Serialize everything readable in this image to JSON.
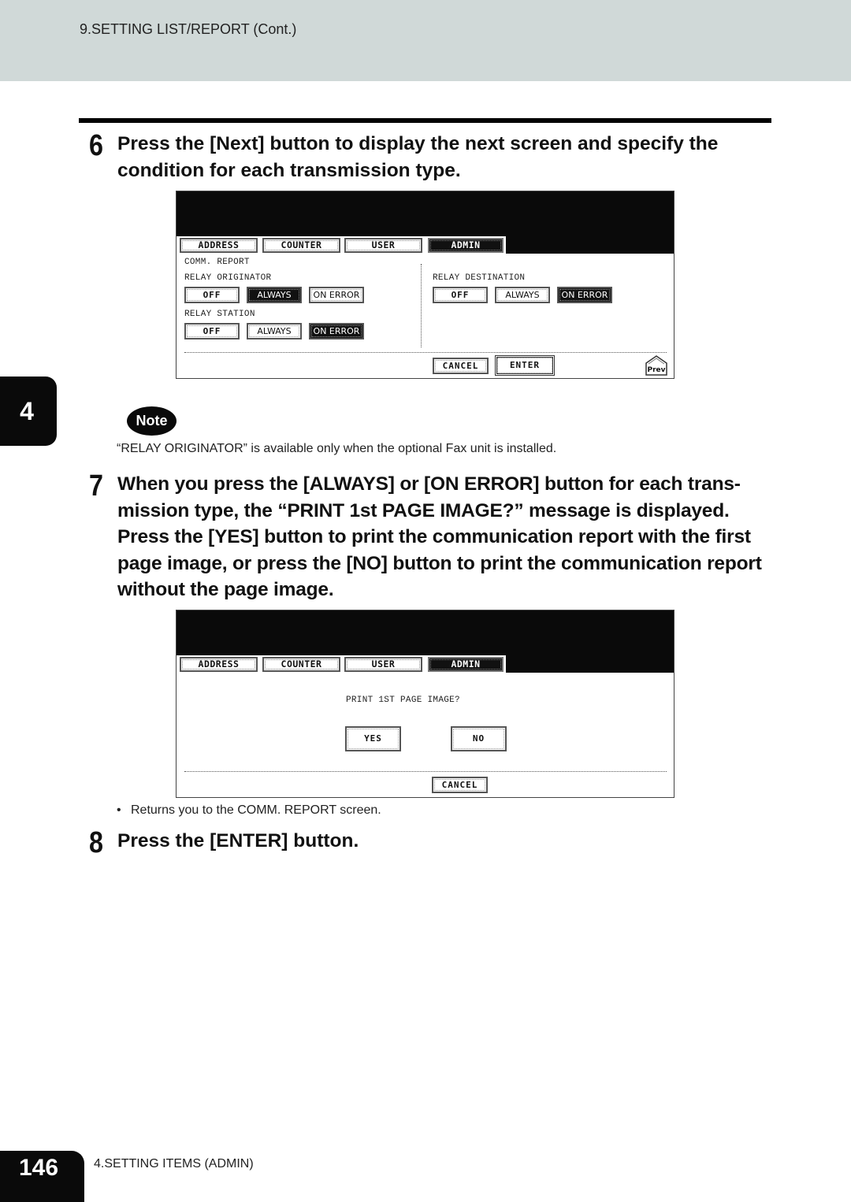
{
  "header": {
    "section_title": "9.SETTING LIST/REPORT (Cont.)"
  },
  "steps": [
    {
      "number": "6",
      "text": "Press the [Next] button to display the next screen and specify the condition for each transmission type."
    },
    {
      "number": "7",
      "text": "When you press the [ALWAYS] or [ON ERROR] button for each trans- mission type, the “PRINT 1st PAGE IMAGE?” message is displayed. Press the [YES] button to print the communication report with the first page image, or press the [NO] button to print the communication report without the page image."
    },
    {
      "number": "8",
      "text": "Press the [ENTER] button."
    }
  ],
  "screen1": {
    "tabs": [
      {
        "label": "ADDRESS",
        "active": false
      },
      {
        "label": "COUNTER",
        "active": false
      },
      {
        "label": "USER",
        "active": false
      },
      {
        "label": "ADMIN",
        "active": true
      }
    ],
    "title": "COMM. REPORT",
    "groups": [
      {
        "label": "RELAY ORIGINATOR",
        "options": [
          "OFF",
          "ALWAYS",
          "ON ERROR"
        ],
        "selected": "ALWAYS"
      },
      {
        "label": "RELAY STATION",
        "options": [
          "OFF",
          "ALWAYS",
          "ON ERROR"
        ],
        "selected": "ON ERROR"
      },
      {
        "label": "RELAY DESTINATION",
        "options": [
          "OFF",
          "ALWAYS",
          "ON ERROR"
        ],
        "selected": "ON ERROR"
      }
    ],
    "cancel_label": "CANCEL",
    "enter_label": "ENTER",
    "prev_label": "Prev"
  },
  "note": {
    "badge": "Note",
    "text": "“RELAY ORIGINATOR” is available only when the optional Fax unit is installed."
  },
  "screen2": {
    "tabs": [
      {
        "label": "ADDRESS",
        "active": false
      },
      {
        "label": "COUNTER",
        "active": false
      },
      {
        "label": "USER",
        "active": false
      },
      {
        "label": "ADMIN",
        "active": true
      }
    ],
    "message": "PRINT 1ST PAGE IMAGE?",
    "yes_label": "YES",
    "no_label": "NO",
    "cancel_label": "CANCEL"
  },
  "bullet": {
    "marker": "•",
    "text": "Returns you to the COMM. REPORT screen."
  },
  "chapter": {
    "number": "4"
  },
  "footer": {
    "page_number": "146",
    "chapter_title": "4.SETTING ITEMS (ADMIN)"
  }
}
